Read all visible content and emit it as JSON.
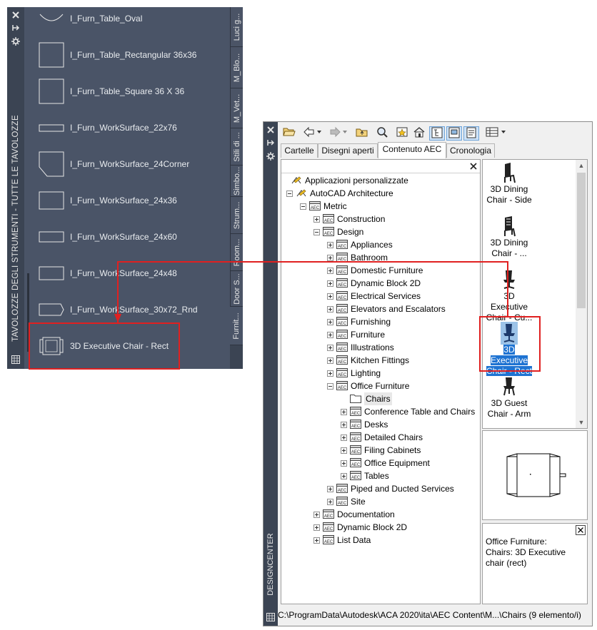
{
  "palette": {
    "title": "TAVOLOZZE DEGLI STRUMENTI - TUTTE LE TAVOLOZZE",
    "items": [
      {
        "label": "I_Furn_Table_Oval"
      },
      {
        "label": "I_Furn_Table_Rectangular 36x36"
      },
      {
        "label": "I_Furn_Table_Square 36 X 36"
      },
      {
        "label": "I_Furn_WorkSurface_22x76"
      },
      {
        "label": "I_Furn_WorkSurface_24Corner"
      },
      {
        "label": "I_Furn_WorkSurface_24x36"
      },
      {
        "label": "I_Furn_WorkSurface_24x60"
      },
      {
        "label": "I_Furn_WorkSurface_24x48"
      },
      {
        "label": "I_Furn_WorkSurface_30x72_Rnd"
      },
      {
        "label": "3D Executive Chair - Rect"
      }
    ],
    "tabs": [
      "Luci g...",
      "M_Blo...",
      "M_Vet...",
      "Stili di ...",
      "Simbo...",
      "Strum...",
      "Room...",
      "Door S...",
      "Furnit..."
    ]
  },
  "designcenter": {
    "title": "DESIGNCENTER",
    "tabs": [
      "Cartelle",
      "Disegni aperti",
      "Contenuto AEC",
      "Cronologia"
    ],
    "tree": [
      {
        "label": "Applicazioni personalizzate"
      },
      {
        "label": "AutoCAD Architecture"
      },
      {
        "label": "Metric"
      },
      {
        "label": "Construction"
      },
      {
        "label": "Design"
      },
      {
        "label": "Appliances"
      },
      {
        "label": "Bathroom"
      },
      {
        "label": "Domestic Furniture"
      },
      {
        "label": "Dynamic Block 2D"
      },
      {
        "label": "Electrical Services"
      },
      {
        "label": "Elevators and Escalators"
      },
      {
        "label": "Furnishing"
      },
      {
        "label": "Furniture"
      },
      {
        "label": "Illustrations"
      },
      {
        "label": "Kitchen Fittings"
      },
      {
        "label": "Lighting"
      },
      {
        "label": "Office Furniture"
      },
      {
        "label": "Chairs"
      },
      {
        "label": "Conference Table and Chairs"
      },
      {
        "label": "Desks"
      },
      {
        "label": "Detailed Chairs"
      },
      {
        "label": "Filing Cabinets"
      },
      {
        "label": "Office Equipment"
      },
      {
        "label": "Tables"
      },
      {
        "label": "Piped and Ducted Services"
      },
      {
        "label": "Site"
      },
      {
        "label": "Documentation"
      },
      {
        "label": "Dynamic Block 2D"
      },
      {
        "label": "List Data"
      }
    ],
    "icons": [
      {
        "line1": "3D Dining",
        "line2": "Chair - Side"
      },
      {
        "line1": "3D Dining",
        "line2": "Chair - ..."
      },
      {
        "line1": "3D Executive",
        "line2": "Chair - Cu..."
      },
      {
        "line1": "3D Executive",
        "line2": "Chair - Rect"
      },
      {
        "line1": "3D Guest",
        "line2": "Chair - Arm"
      }
    ],
    "description": "Office Furniture: Chairs: 3D Executive chair (rect)",
    "status": "C:\\ProgramData\\Autodesk\\ACA 2020\\ita\\AEC Content\\M...\\Chairs (9 elemento/i)"
  },
  "colors": {
    "highlight": "#e02020",
    "panel_dark": "#4a5467",
    "selection": "#1e73d2"
  }
}
